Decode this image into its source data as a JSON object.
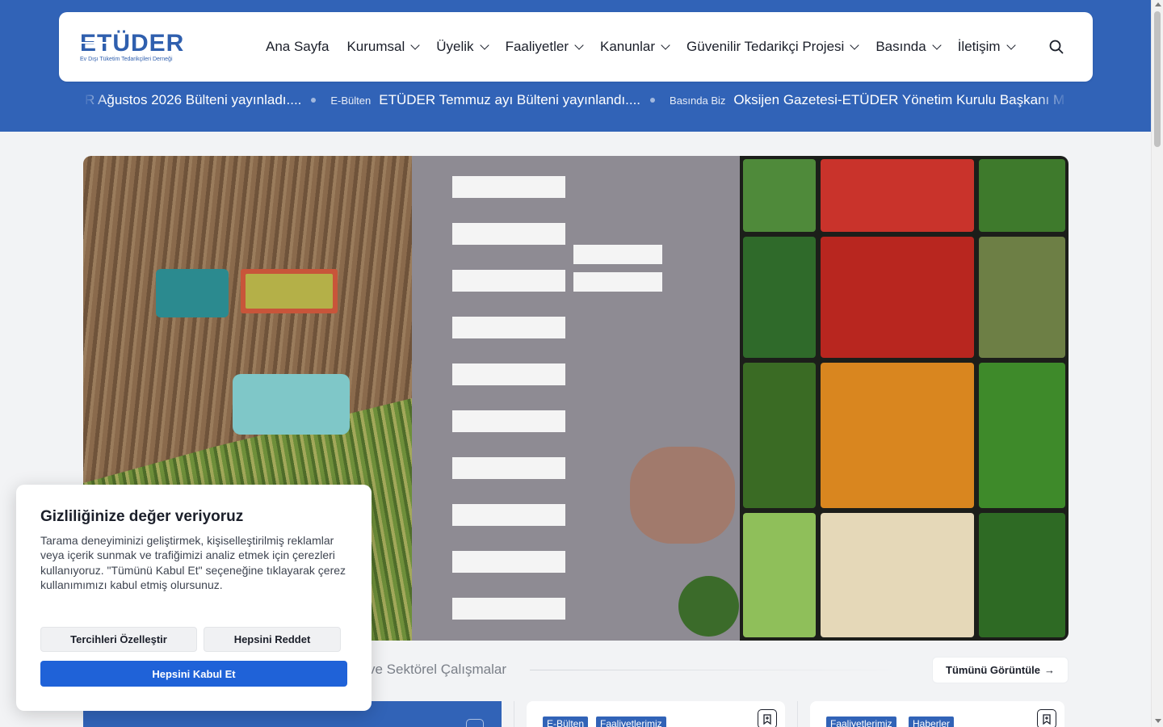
{
  "brand": {
    "name": "ETÜDER",
    "tagline": "Ev Dışı Tüketim Tedarikçileri Derneği",
    "primary_color": "#3163b7"
  },
  "nav": {
    "items": [
      {
        "label": "Ana Sayfa",
        "has_dropdown": false
      },
      {
        "label": "Kurumsal",
        "has_dropdown": true
      },
      {
        "label": "Üyelik",
        "has_dropdown": true
      },
      {
        "label": "Faaliyetler",
        "has_dropdown": true
      },
      {
        "label": "Kanunlar",
        "has_dropdown": true
      },
      {
        "label": "Güvenilir Tedarikçi Projesi",
        "has_dropdown": true
      },
      {
        "label": "Basında",
        "has_dropdown": true
      },
      {
        "label": "İletişim",
        "has_dropdown": true
      }
    ],
    "search_icon": "search-icon"
  },
  "ticker": {
    "items": [
      {
        "category": "",
        "title": "R Ağustos 2026 Bülteni yayınladı...."
      },
      {
        "category": "E-Bülten",
        "title": "ETÜDER Temmuz ayı Bülteni yayınlandı...."
      },
      {
        "category": "Basında Biz",
        "title": "Oksijen Gazetesi-ETÜDER Yönetim Kurulu Başkanı M"
      }
    ]
  },
  "hero": {
    "image": "Tarım, lojistik ve sebze tezgahı kolajı"
  },
  "section": {
    "title": "ve Sektörel Çalışmalar",
    "view_all": "Tümünü Görüntüle",
    "view_all_icon": "arrow-right-icon"
  },
  "cards": [
    {
      "tags": [
        "E-Bülten",
        "Faaliyetlerimiz"
      ]
    },
    {
      "tags": [
        "Faaliyetlerimiz",
        "Haberler"
      ]
    }
  ],
  "cookie": {
    "title": "Gizliliğinize değer veriyoruz",
    "text": "Tarama deneyiminizi geliştirmek, kişiselleştirilmiş reklamlar veya içerik sunmak ve trafiğimizi analiz etmek için çerezleri kullanıyoruz. \"Tümünü Kabul Et\" seçeneğine tıklayarak çerez kullanımımızı kabul etmiş olursunuz.",
    "customize": "Tercihleri Özelleştir",
    "reject": "Hepsini Reddet",
    "accept": "Hepsini Kabul Et",
    "accept_color": "#1f62d8"
  }
}
